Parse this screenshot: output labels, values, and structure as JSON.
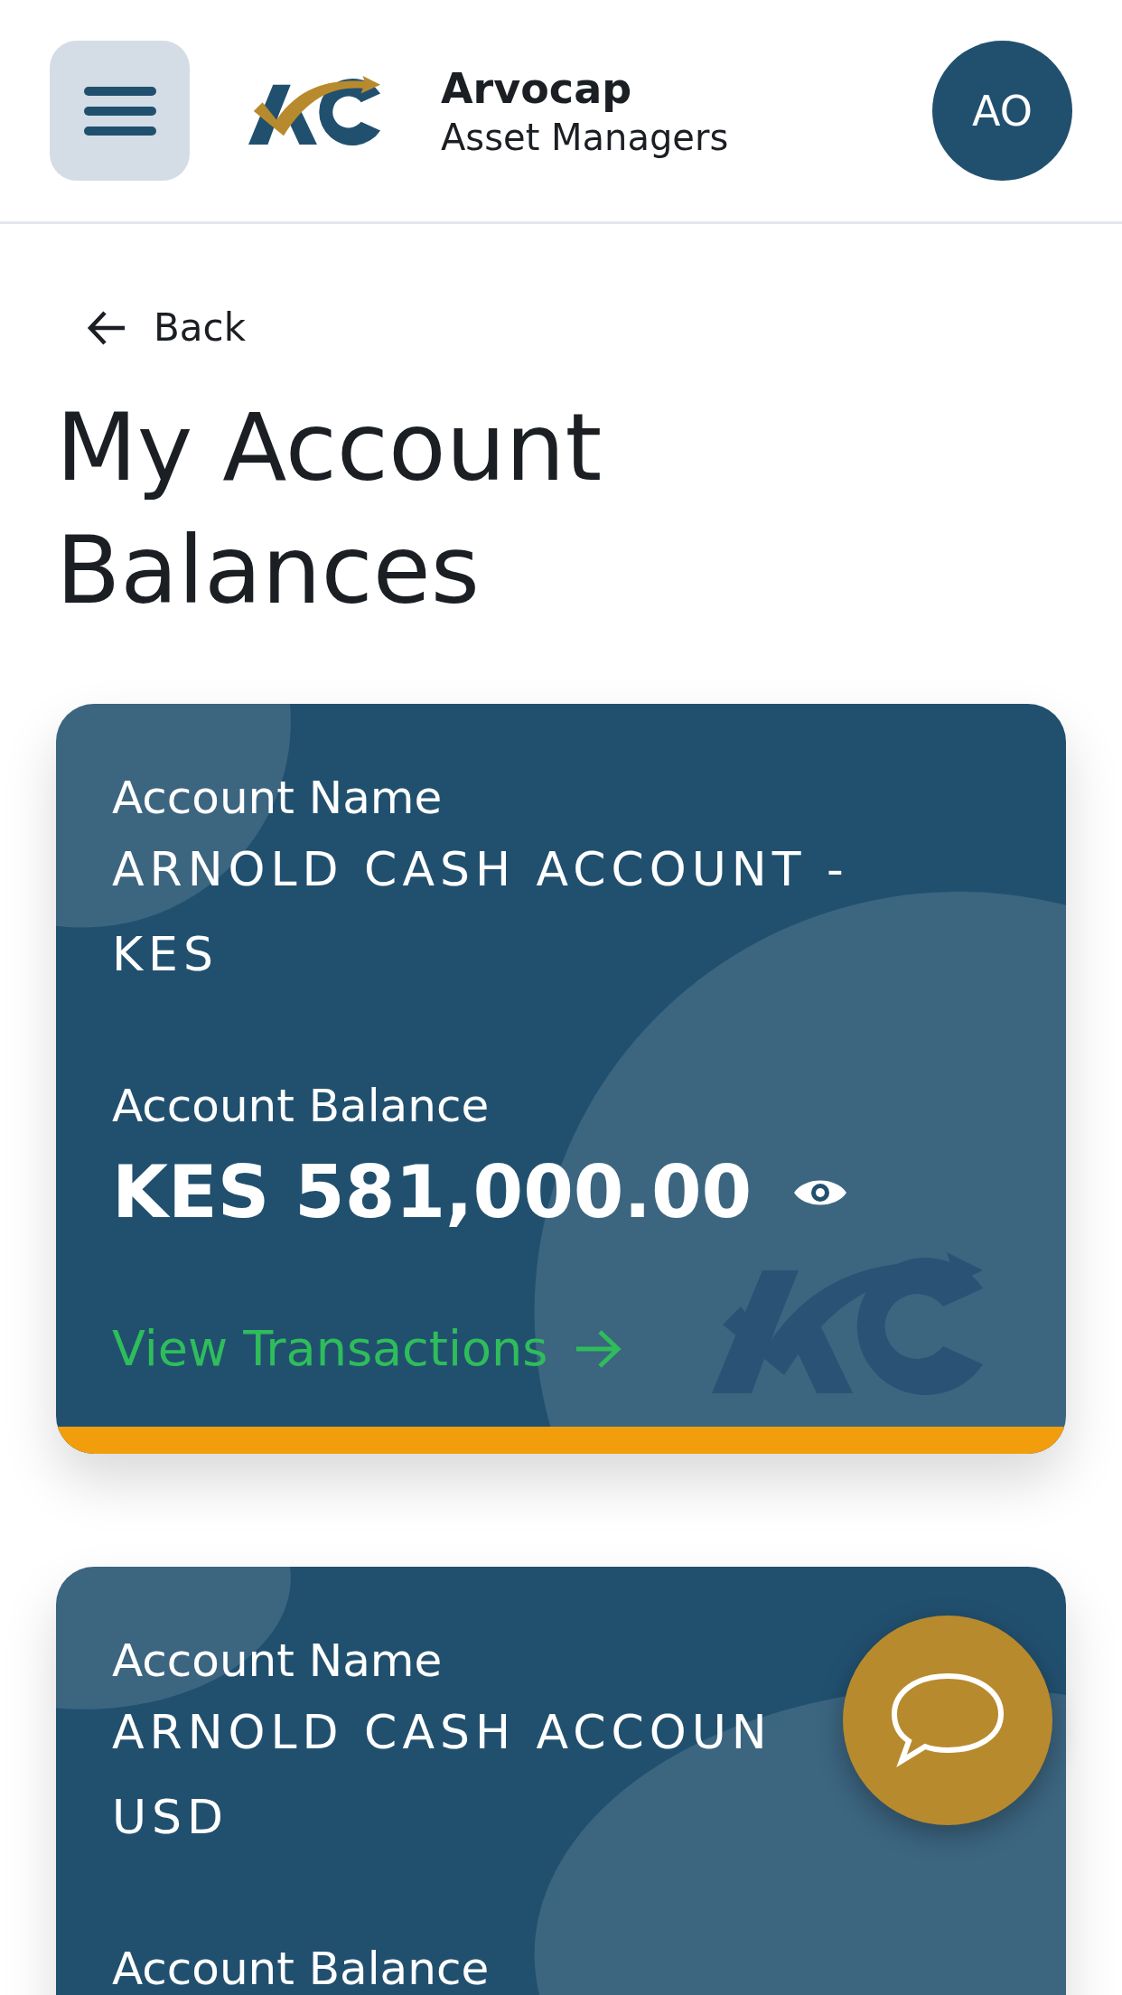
{
  "header": {
    "brand_name": "Arvocap",
    "brand_tagline": "Asset Managers",
    "avatar_initials": "AO"
  },
  "back_link": "Back",
  "page_title": "My Account Balances",
  "accounts": [
    {
      "name_label": "Account Name",
      "name_lines": [
        "ARNOLD CASH ACCOUNT -",
        "KES"
      ],
      "balance_label": "Account Balance",
      "balance": "KES 581,000.00",
      "link": "View Transactions"
    },
    {
      "name_label": "Account Name",
      "name_lines": [
        "ARNOLD CASH ACCOUN",
        "USD"
      ],
      "balance_label": "Account Balance"
    }
  ]
}
